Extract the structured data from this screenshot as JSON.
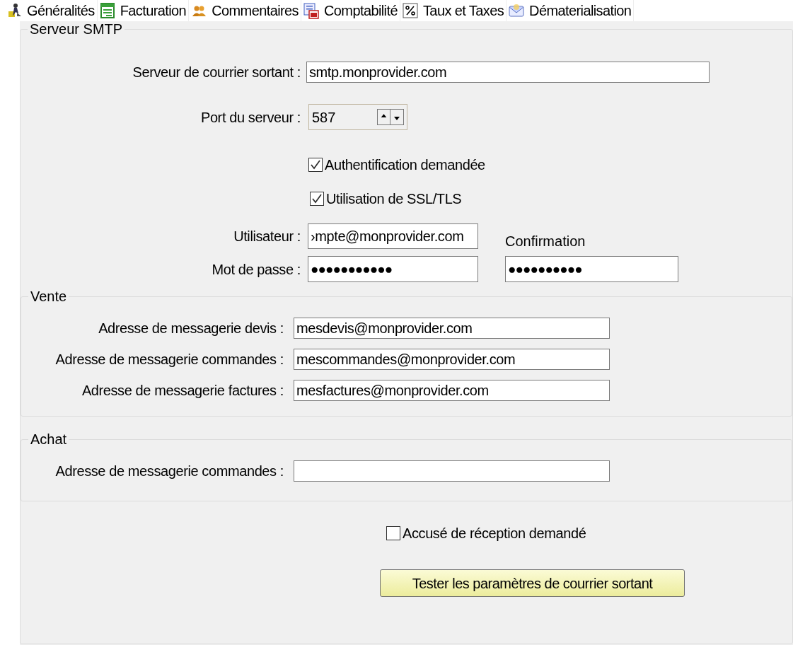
{
  "tabs": [
    {
      "label": "Généralités"
    },
    {
      "label": "Facturation"
    },
    {
      "label": "Commentaires"
    },
    {
      "label": "Comptabilité"
    },
    {
      "label": "Taux et Taxes"
    },
    {
      "label": "Dématerialisation"
    }
  ],
  "smtp": {
    "legend": "Serveur SMTP",
    "server": {
      "label": "Serveur de courrier sortant :",
      "value": "smtp.monprovider.com"
    },
    "port": {
      "label": "Port du serveur :",
      "value": "587"
    },
    "options": [
      {
        "label": "Authentification demandée",
        "checked": true
      },
      {
        "label": "Utilisation de SSL/TLS",
        "checked": true
      }
    ],
    "user": {
      "label": "Utilisateur :",
      "value": "›mpte@monprovider.com"
    },
    "password": {
      "label": "Mot de passe :",
      "value": "●●●●●●●●●●●"
    },
    "confirmation": {
      "label": "Confirmation",
      "value": "●●●●●●●●●●"
    },
    "vente": {
      "legend": "Vente",
      "fields": [
        {
          "label": "Adresse de messagerie devis :",
          "value": "mesdevis@monprovider.com"
        },
        {
          "label": "Adresse de messagerie commandes :",
          "value": "mescommandes@monprovider.com"
        },
        {
          "label": "Adresse de messagerie factures :",
          "value": "mesfactures@monprovider.com"
        }
      ]
    },
    "achat": {
      "legend": "Achat",
      "fields": [
        {
          "label": "Adresse de messagerie commandes :"
        }
      ]
    },
    "receipt": {
      "label": "Accusé de réception demandé",
      "checked": false
    },
    "test_button": "Tester les paramètres de courrier sortant"
  }
}
